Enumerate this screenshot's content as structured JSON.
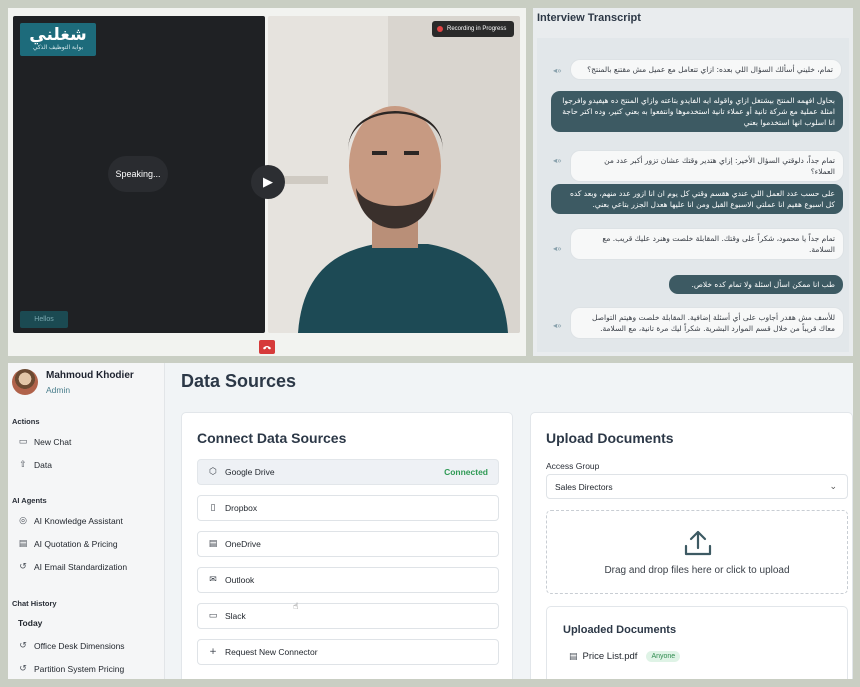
{
  "interview": {
    "logo_text": "شغلني",
    "logo_subtitle": "بوابة التوظيف الذكي",
    "speaking_label": "Speaking...",
    "ai_badge": "Hellos",
    "recording_label": "Recording in Progress"
  },
  "transcript": {
    "title": "Interview Transcript",
    "messages": [
      {
        "role": "q",
        "text": "تمام، خليني أسألك السؤال اللي بعده: ازاي تتعامل مع عميل مش مقتنع بالمنتج؟"
      },
      {
        "role": "a",
        "text": "بحاول افهمه المنتج بيشتغل ازاي واقوله ايه الفايدو بتاعته وازاي المنتج ده هيفيدو وافرجوا امثلة عملية مع شركة تانية أو عملاء تانية استخدموها وانتفعوا به بعني كتير، وده اكتر حاجة انا اسلوب انها استخدموا بعني"
      },
      {
        "role": "q",
        "text": "تمام جداً، دلوقتي السؤال الأخير: إزاي هتدير وقتك عشان تزور أكبر عدد من العملاء؟"
      },
      {
        "role": "a",
        "text": "على حسب عدد العمل اللي عندي هقسم وقتي كل يوم ان انا ازور عدد منهم، وبعد كده كل اسبوع هقيم انا عملتي الاسبوع القبل ومن انا عليها هعدل الجزر بتاعي بعني."
      },
      {
        "role": "q",
        "text": "تمام جداً يا محمود، شكراً على وقتك. المقابلة خلصت وهنرد عليك قريب. مع السلامة."
      },
      {
        "role": "a",
        "text": "طب انا ممكن اسأل اسئلة ولا تمام كده خلاص."
      },
      {
        "role": "q",
        "text": "للأسف مش هقدر أجاوب على أي أسئلة إضافية. المقابلة خلصت وهيتم التواصل معاك قريباً من خلال قسم الموارد البشرية. شكراً ليك مرة تانية، مع السلامة."
      }
    ]
  },
  "sidebar": {
    "user_name": "Mahmoud Khodier",
    "user_role": "Admin",
    "actions_label": "Actions",
    "new_chat": "New Chat",
    "data": "Data",
    "agents_label": "AI Agents",
    "agents": [
      "AI Knowledge Assistant",
      "AI Quotation & Pricing",
      "AI Email Standardization"
    ],
    "history_label": "Chat History",
    "today_label": "Today",
    "history": [
      "Office Desk Dimensions",
      "Partition System Pricing"
    ]
  },
  "main": {
    "page_title": "Data Sources",
    "connect_title": "Connect Data Sources",
    "sources": [
      {
        "name": "Google Drive",
        "status": "Connected",
        "icon": "drive-icon"
      },
      {
        "name": "Dropbox",
        "icon": "dropbox-icon"
      },
      {
        "name": "OneDrive",
        "icon": "document-icon"
      },
      {
        "name": "Outlook",
        "icon": "mail-icon"
      },
      {
        "name": "Slack",
        "icon": "chat-icon"
      },
      {
        "name": "Request New Connector",
        "icon": "plus-icon"
      }
    ],
    "upload_title": "Upload Documents",
    "access_group_label": "Access Group",
    "access_group_value": "Sales Directors",
    "drop_text": "Drag and drop files here or click to upload",
    "uploaded_title": "Uploaded Documents",
    "file_name": "Price List.pdf",
    "file_badge": "Anyone"
  },
  "colors": {
    "accent": "#2f9a55",
    "answer_bubble": "#3d5a63",
    "end_call": "#d63a3a"
  }
}
